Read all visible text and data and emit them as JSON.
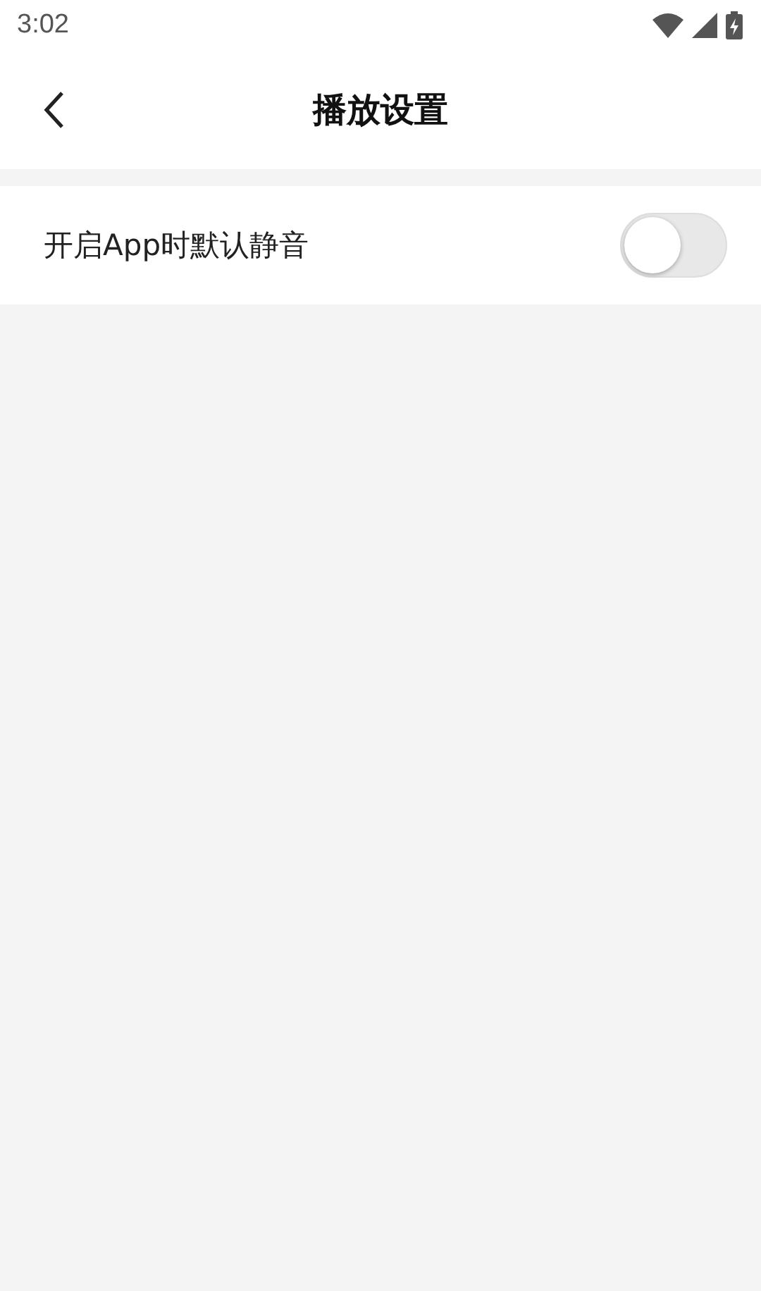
{
  "status_bar": {
    "time": "3:02"
  },
  "header": {
    "title": "播放设置"
  },
  "settings": [
    {
      "kind": "toggle",
      "label": "开启App时默认静音",
      "on": false
    }
  ]
}
